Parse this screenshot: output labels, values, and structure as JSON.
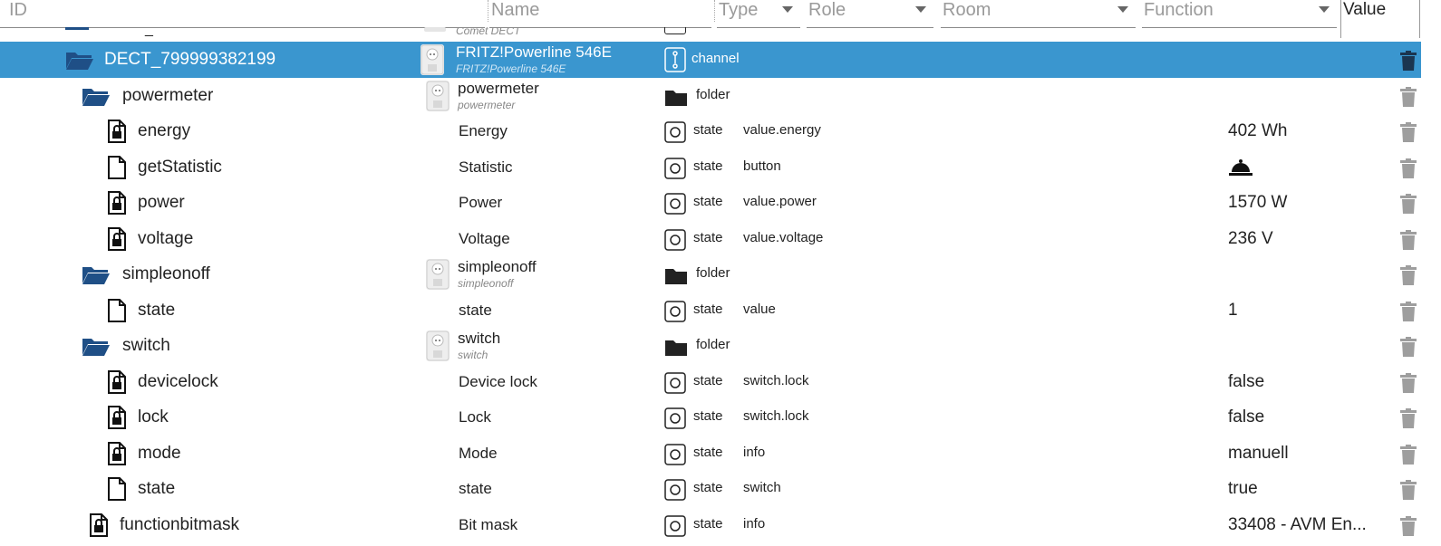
{
  "header": {
    "id_placeholder": "ID",
    "name_placeholder": "Name",
    "type_placeholder": "Type",
    "role_placeholder": "Role",
    "room_placeholder": "Room",
    "function_placeholder": "Function",
    "value_label": "Value"
  },
  "partial_row": {
    "id": "_",
    "name_sub": "Comet DECT"
  },
  "rows": [
    {
      "id": "DECT_799999382199",
      "name": "FRITZ!Powerline 546E",
      "name_sub": "FRITZ!Powerline 546E",
      "type": "channel",
      "role": "",
      "value": "",
      "kind": "folder-open",
      "selected": true
    },
    {
      "id": "powermeter",
      "name": "powermeter",
      "name_sub": "powermeter",
      "type": "folder",
      "role": "",
      "value": "",
      "kind": "folder-open"
    },
    {
      "id": "energy",
      "name": "Energy",
      "type": "state",
      "role": "value.energy",
      "value": "402 Wh",
      "kind": "file-lock"
    },
    {
      "id": "getStatistic",
      "name": "Statistic",
      "type": "state",
      "role": "button",
      "value": "",
      "kind": "file",
      "bell": true
    },
    {
      "id": "power",
      "name": "Power",
      "type": "state",
      "role": "value.power",
      "value": "1570 W",
      "kind": "file-lock"
    },
    {
      "id": "voltage",
      "name": "Voltage",
      "type": "state",
      "role": "value.voltage",
      "value": "236 V",
      "kind": "file-lock"
    },
    {
      "id": "simpleonoff",
      "name": "simpleonoff",
      "name_sub": "simpleonoff",
      "type": "folder",
      "role": "",
      "value": "",
      "kind": "folder-open"
    },
    {
      "id": "state",
      "name": "state",
      "type": "state",
      "role": "value",
      "value": "1",
      "kind": "file"
    },
    {
      "id": "switch",
      "name": "switch",
      "name_sub": "switch",
      "type": "folder",
      "role": "",
      "value": "",
      "kind": "folder-open"
    },
    {
      "id": "devicelock",
      "name": "Device lock",
      "type": "state",
      "role": "switch.lock",
      "value": "false",
      "kind": "file-lock"
    },
    {
      "id": "lock",
      "name": "Lock",
      "type": "state",
      "role": "switch.lock",
      "value": "false",
      "kind": "file-lock"
    },
    {
      "id": "mode",
      "name": "Mode",
      "type": "state",
      "role": "info",
      "value": "manuell",
      "kind": "file-lock"
    },
    {
      "id": "state",
      "name": "state",
      "type": "state",
      "role": "switch",
      "value": "true",
      "kind": "file"
    },
    {
      "id": "functionbitmask",
      "name": "Bit mask",
      "type": "state",
      "role": "info",
      "value": "33408 - AVM En...",
      "kind": "file-lock"
    }
  ],
  "colors": {
    "selected": "#3a96cf",
    "folder_icon": "#1f4f86",
    "trash": "#9e9e9e"
  }
}
